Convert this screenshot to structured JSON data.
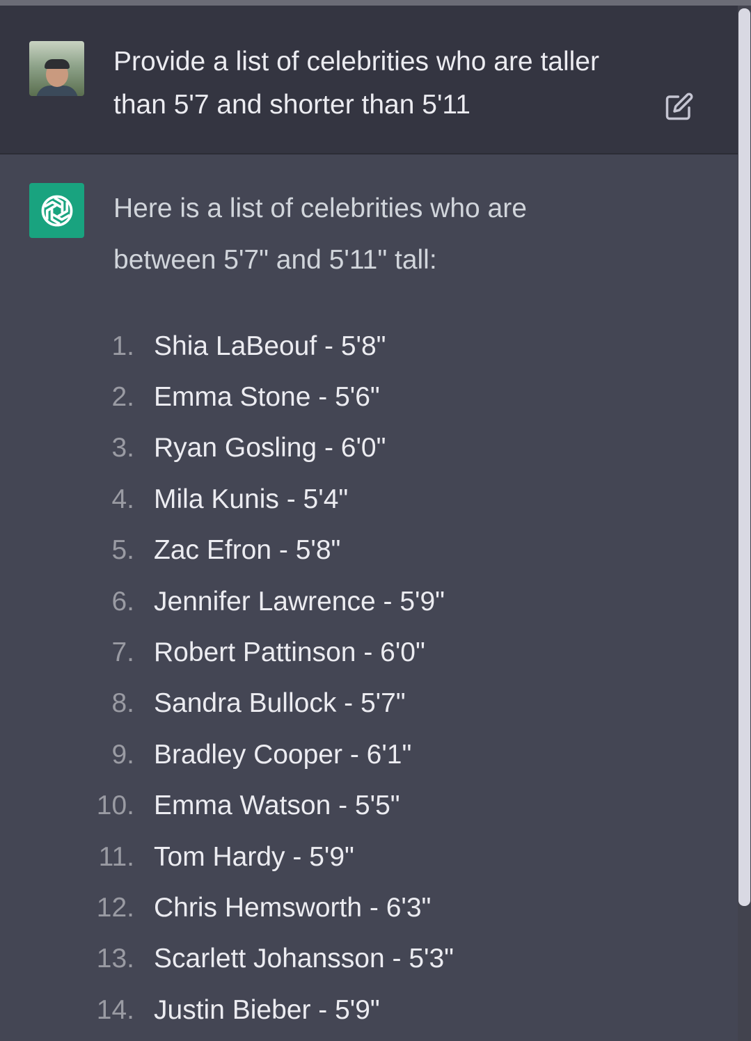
{
  "user_message": {
    "line1": "Provide a list of celebrities who are taller",
    "line2": "than 5'7 and shorter than 5'11"
  },
  "assistant_message": {
    "intro_line1": "Here is a list of celebrities who are",
    "intro_line2": "between 5'7\" and 5'11\" tall:",
    "items": [
      {
        "num": "1.",
        "text": "Shia LaBeouf - 5'8\""
      },
      {
        "num": "2.",
        "text": "Emma Stone - 5'6\""
      },
      {
        "num": "3.",
        "text": "Ryan Gosling - 6'0\""
      },
      {
        "num": "4.",
        "text": "Mila Kunis - 5'4\""
      },
      {
        "num": "5.",
        "text": "Zac Efron - 5'8\""
      },
      {
        "num": "6.",
        "text": "Jennifer Lawrence - 5'9\""
      },
      {
        "num": "7.",
        "text": "Robert Pattinson - 6'0\""
      },
      {
        "num": "8.",
        "text": "Sandra Bullock - 5'7\""
      },
      {
        "num": "9.",
        "text": "Bradley Cooper - 6'1\""
      },
      {
        "num": "10.",
        "text": "Emma Watson - 5'5\""
      },
      {
        "num": "11.",
        "text": "Tom Hardy - 5'9\""
      },
      {
        "num": "12.",
        "text": "Chris Hemsworth - 6'3\""
      },
      {
        "num": "13.",
        "text": "Scarlett Johansson - 5'3\""
      },
      {
        "num": "14.",
        "text": "Justin Bieber - 5'9\""
      }
    ]
  },
  "icons": {
    "user_avatar": "user-avatar-photo",
    "assistant_avatar": "openai-logo-icon",
    "edit": "edit-pencil-icon"
  },
  "colors": {
    "user_bg": "#343541",
    "assistant_bg": "#444654",
    "gpt_avatar_bg": "#19a37f",
    "text_primary": "#ececf1",
    "list_number": "#9a9ba3"
  }
}
